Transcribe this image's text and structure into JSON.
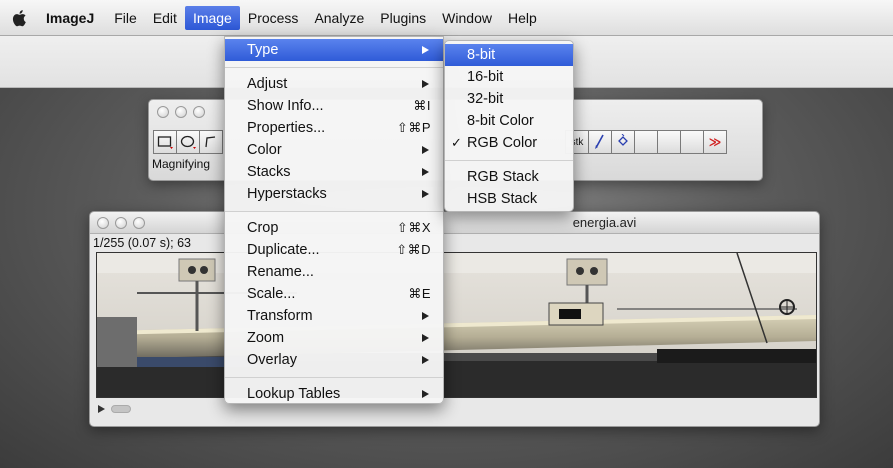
{
  "menubar": {
    "apple_icon": "apple-logo-icon",
    "app_name": "ImageJ",
    "items": [
      "File",
      "Edit",
      "Image",
      "Process",
      "Analyze",
      "Plugins",
      "Window",
      "Help"
    ],
    "active": "Image"
  },
  "tools_window": {
    "status_text": "Magnifying",
    "tools": [
      "rectangle-selection",
      "oval-selection",
      "polygon-selection"
    ],
    "right_tools": [
      "stk-dropdown",
      "brush",
      "flood-fill",
      "empty",
      "empty",
      "empty"
    ],
    "right_tool_labels": {
      "stk": "stk",
      "more": "≫"
    }
  },
  "video_window": {
    "title": "energia.avi",
    "info": "1/255 (0.07 s); 63"
  },
  "image_menu": {
    "groups": [
      [
        {
          "label": "Type",
          "submenu": true,
          "highlighted": true
        }
      ],
      [
        {
          "label": "Adjust",
          "submenu": true
        },
        {
          "label": "Show Info...",
          "shortcut": "⌘I"
        },
        {
          "label": "Properties...",
          "shortcut": "⇧⌘P"
        },
        {
          "label": "Color",
          "submenu": true
        },
        {
          "label": "Stacks",
          "submenu": true
        },
        {
          "label": "Hyperstacks",
          "submenu": true
        }
      ],
      [
        {
          "label": "Crop",
          "shortcut": "⇧⌘X"
        },
        {
          "label": "Duplicate...",
          "shortcut": "⇧⌘D"
        },
        {
          "label": "Rename..."
        },
        {
          "label": "Scale...",
          "shortcut": "⌘E"
        },
        {
          "label": "Transform",
          "submenu": true
        },
        {
          "label": "Zoom",
          "submenu": true
        },
        {
          "label": "Overlay",
          "submenu": true
        }
      ],
      [
        {
          "label": "Lookup Tables",
          "submenu": true
        }
      ]
    ]
  },
  "type_submenu": {
    "check_mark": "✓",
    "groups": [
      [
        {
          "label": "8-bit",
          "highlighted": true
        },
        {
          "label": "16-bit"
        },
        {
          "label": "32-bit"
        },
        {
          "label": "8-bit Color"
        },
        {
          "label": "RGB Color",
          "checked": true
        }
      ],
      [
        {
          "label": "RGB Stack"
        },
        {
          "label": "HSB Stack"
        }
      ]
    ]
  },
  "colors": {
    "highlight": "#2f5bd8",
    "menu_bg": "#f5f5f5",
    "desktop": "#5e5e5e"
  }
}
